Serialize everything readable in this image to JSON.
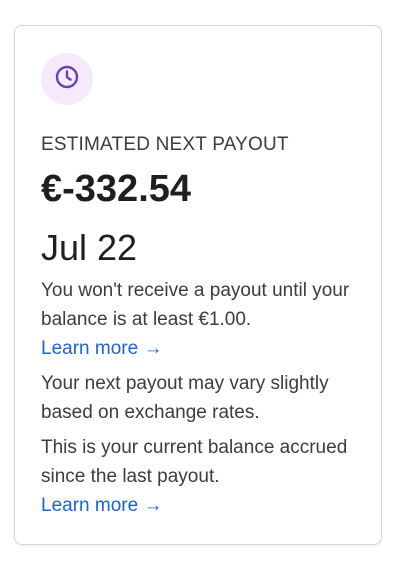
{
  "card": {
    "icon": "clock-icon",
    "accent_color": "#6b3fb3",
    "icon_bg_color": "#f4eafc",
    "link_color": "#1f64c4",
    "eyebrow": "ESTIMATED NEXT PAYOUT",
    "amount": "€-332.54",
    "date": "Jul 22",
    "notice_1": "You won't receive a payout until your balance is at least €1.00.",
    "learn_more_1": "Learn more →",
    "notice_2": "Your next payout may vary slightly based on exchange rates.",
    "notice_3": "This is your current balance accrued since the last payout.",
    "learn_more_2": "Learn more →"
  }
}
